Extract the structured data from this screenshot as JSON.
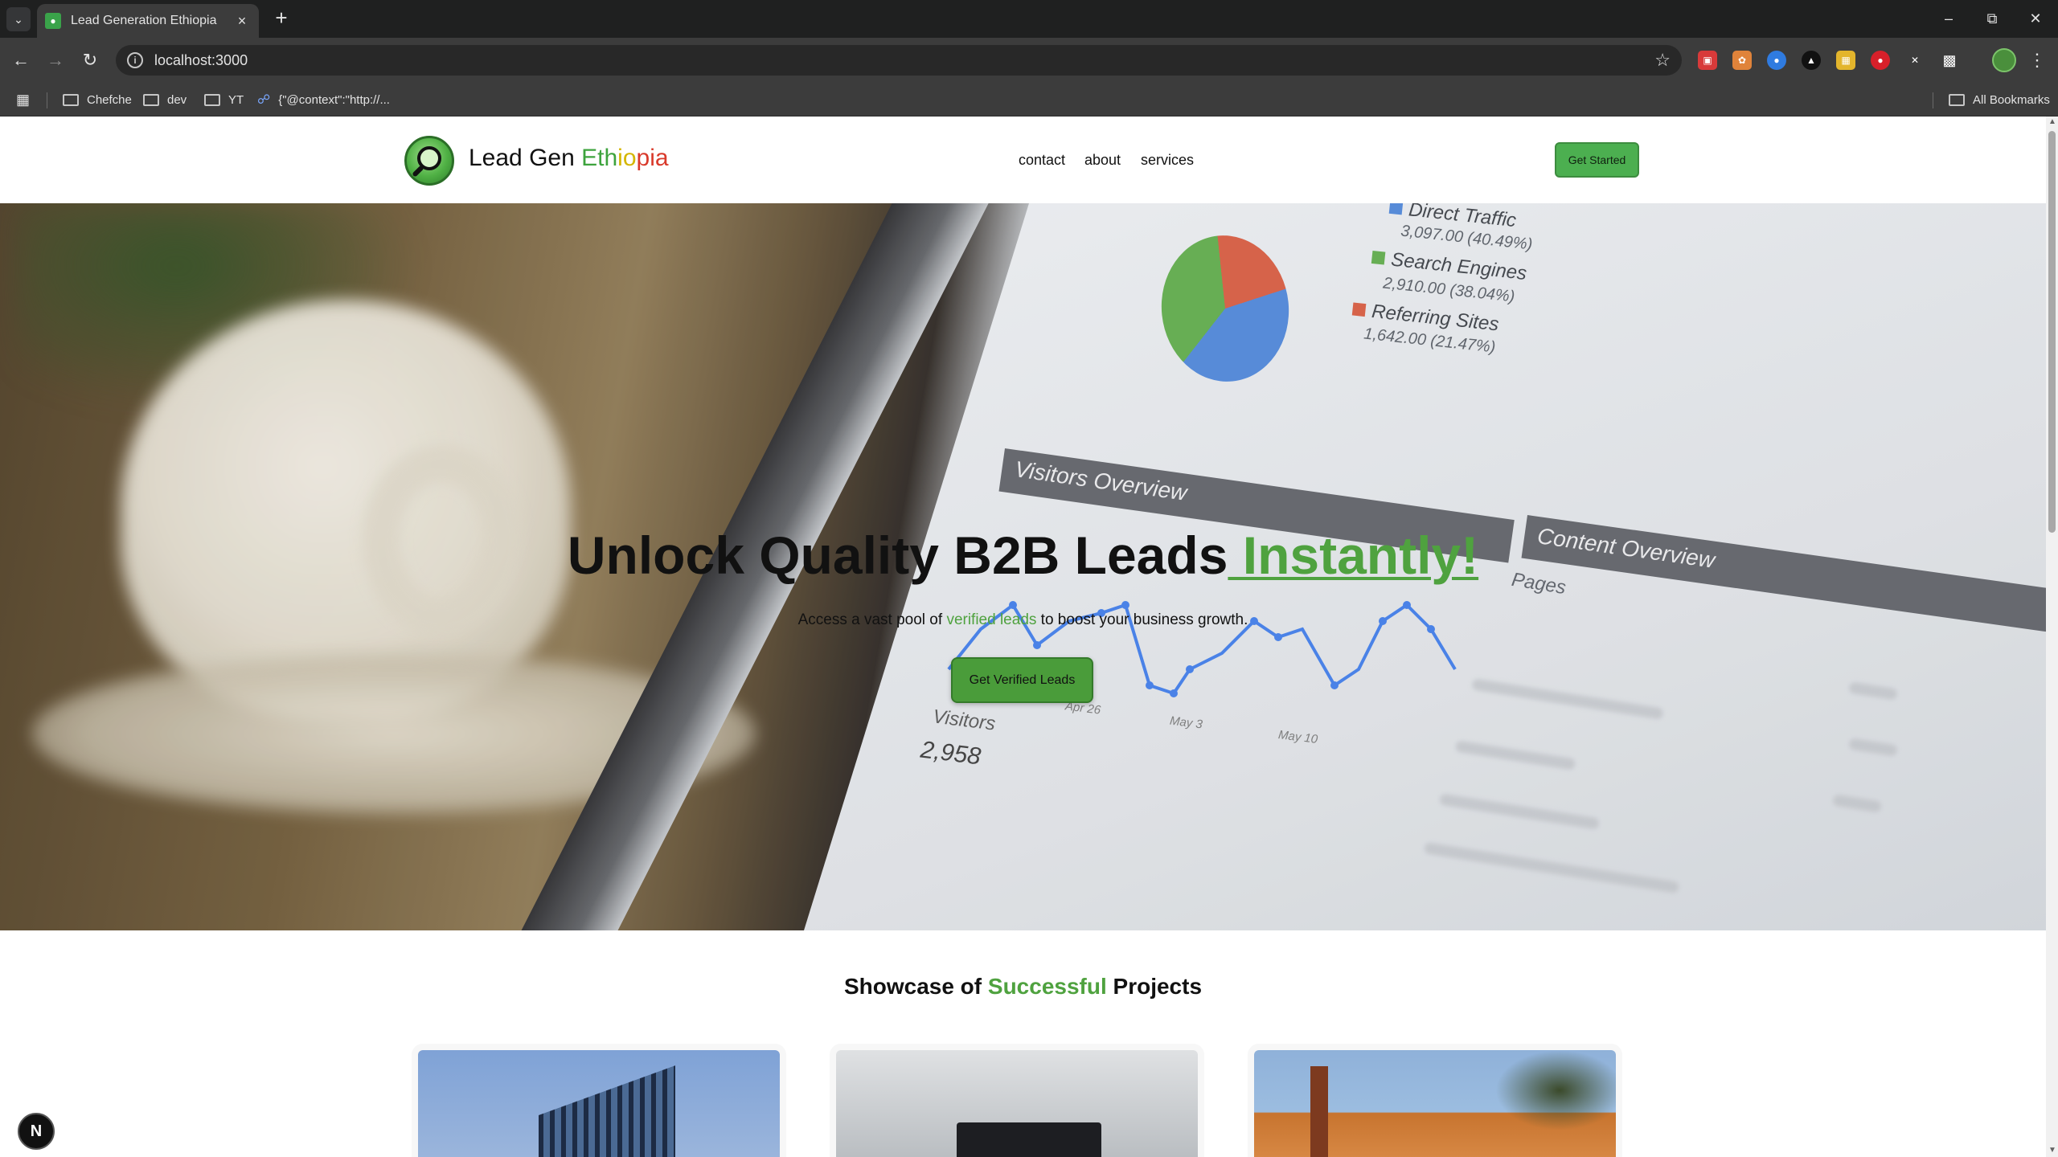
{
  "browser": {
    "tab_title": "Lead Generation Ethiopia",
    "url": "localhost:3000",
    "bookmarks": [
      "Chefche",
      "dev",
      "YT",
      "{\"@context\":\"http://..."
    ],
    "all_bookmarks_label": "All Bookmarks",
    "icons": {
      "tab_search": "chevron-down-icon",
      "new_tab": "plus-icon",
      "back": "back-arrow-icon",
      "forward": "forward-arrow-icon",
      "reload": "reload-icon",
      "site_info": "info-icon",
      "bookmark_star": "star-icon",
      "apps": "apps-grid-icon",
      "extensions": "puzzle-icon",
      "menu": "kebab-menu-icon"
    }
  },
  "site": {
    "brand": {
      "word1": "Lead Gen ",
      "ethiopia_parts": [
        "Eth",
        "io",
        "pia"
      ]
    },
    "nav": {
      "links": [
        "contact",
        "about",
        "services"
      ],
      "cta": "Get Started"
    },
    "hero": {
      "title_main": "Unlock Quality B2B Leads",
      "title_accent": " Instantly!",
      "sub_before": "Access a vast pool of ",
      "sub_accent": "verified leads",
      "sub_after": " to boost your business growth.",
      "cta": "Get Verified Leads",
      "background_photo": {
        "legend": [
          {
            "name": "Direct Traffic",
            "value": "3,097.00 (40.49%)",
            "color": "#4d84d6"
          },
          {
            "name": "Search Engines",
            "value": "2,910.00 (38.04%)",
            "color": "#5ea94a"
          },
          {
            "name": "Referring Sites",
            "value": "1,642.00 (21.47%)",
            "color": "#d45a3f"
          }
        ],
        "panel_visitors": "Visitors Overview",
        "panel_content": "Content Overview",
        "pages_label": "Pages",
        "visitors_label": "Visitors",
        "visitors_value": "2,958",
        "axis_ticks": [
          "Apr 26",
          "May 3",
          "May 10"
        ]
      }
    },
    "showcase": {
      "title_before": "Showcase of ",
      "title_accent": "Successful",
      "title_after": " Projects"
    },
    "dev_badge": "N"
  },
  "colors": {
    "accent_green": "#4fa23f",
    "button_green": "#4caf50",
    "chrome_dark": "#1f2020",
    "chrome_toolbar": "#3c3c3c"
  }
}
